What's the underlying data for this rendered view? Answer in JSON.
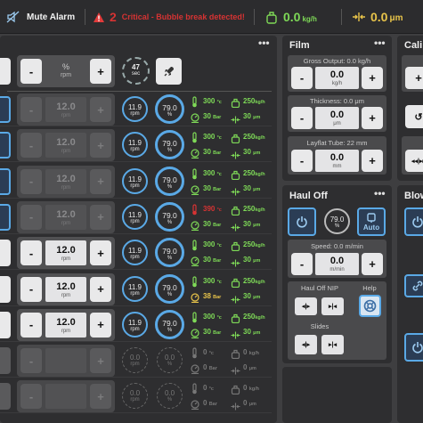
{
  "topbar": {
    "mute_label": "Mute Alarm",
    "alarm_count": "2",
    "alarm_text": "Critical - Bubble break detected!",
    "speed_value": "0.0",
    "speed_unit": "kg/h",
    "thickness_value": "0.0",
    "thickness_unit": "μm"
  },
  "extruder": {
    "header": {
      "value": "%",
      "unit": "rpm",
      "minus": "-",
      "plus": "+",
      "timer_value": "47",
      "timer_unit": "sec"
    },
    "rows": [
      {
        "rpm": "12.0",
        "unit": "rpm",
        "active": false,
        "current": "11.9",
        "current_unit": "rpm",
        "load": "79.0",
        "load_unit": "%",
        "temp": "300",
        "temp_unit": "°c",
        "pressure": "30",
        "pressure_unit": "Bar",
        "output": "250",
        "output_unit": "kg/h",
        "thickness": "30",
        "thickness_unit": "μm",
        "temp_alarm": false,
        "pressure_warn": false
      },
      {
        "rpm": "12.0",
        "unit": "rpm",
        "active": false,
        "current": "11.9",
        "current_unit": "rpm",
        "load": "79.0",
        "load_unit": "%",
        "temp": "300",
        "temp_unit": "°c",
        "pressure": "30",
        "pressure_unit": "Bar",
        "output": "250",
        "output_unit": "kg/h",
        "thickness": "30",
        "thickness_unit": "μm",
        "temp_alarm": false,
        "pressure_warn": false
      },
      {
        "rpm": "12.0",
        "unit": "rpm",
        "active": false,
        "current": "11.9",
        "current_unit": "rpm",
        "load": "79.0",
        "load_unit": "%",
        "temp": "300",
        "temp_unit": "°c",
        "pressure": "30",
        "pressure_unit": "Bar",
        "output": "250",
        "output_unit": "kg/h",
        "thickness": "30",
        "thickness_unit": "μm",
        "temp_alarm": false,
        "pressure_warn": false
      },
      {
        "rpm": "12.0",
        "unit": "rpm",
        "active": false,
        "current": "11.9",
        "current_unit": "rpm",
        "load": "79.0",
        "load_unit": "%",
        "temp": "390",
        "temp_unit": "°c",
        "pressure": "30",
        "pressure_unit": "Bar",
        "output": "250",
        "output_unit": "kg/h",
        "thickness": "30",
        "thickness_unit": "μm",
        "temp_alarm": true,
        "pressure_warn": false
      },
      {
        "rpm": "12.0",
        "unit": "rpm",
        "active": true,
        "current": "11.9",
        "current_unit": "rpm",
        "load": "79.0",
        "load_unit": "%",
        "temp": "300",
        "temp_unit": "°c",
        "pressure": "30",
        "pressure_unit": "Bar",
        "output": "250",
        "output_unit": "kg/h",
        "thickness": "30",
        "thickness_unit": "μm",
        "temp_alarm": false,
        "pressure_warn": false
      },
      {
        "rpm": "12.0",
        "unit": "rpm",
        "active": true,
        "current": "11.9",
        "current_unit": "rpm",
        "load": "79.0",
        "load_unit": "%",
        "temp": "300",
        "temp_unit": "°c",
        "pressure": "38",
        "pressure_unit": "Bar",
        "output": "250",
        "output_unit": "kg/h",
        "thickness": "30",
        "thickness_unit": "μm",
        "temp_alarm": false,
        "pressure_warn": true
      },
      {
        "rpm": "12.0",
        "unit": "rpm",
        "active": true,
        "current": "11.9",
        "current_unit": "rpm",
        "load": "79.0",
        "load_unit": "%",
        "temp": "300",
        "temp_unit": "°c",
        "pressure": "30",
        "pressure_unit": "Bar",
        "output": "250",
        "output_unit": "kg/h",
        "thickness": "30",
        "thickness_unit": "μm",
        "temp_alarm": false,
        "pressure_warn": false
      }
    ],
    "off_rows": [
      {
        "current": "0.0",
        "current_unit": "rpm",
        "load": "0.0",
        "load_unit": "%",
        "temp": "0",
        "temp_unit": "°c",
        "pressure": "0",
        "pressure_unit": "Bar",
        "output": "0",
        "output_unit": "kg/h",
        "thickness": "0",
        "thickness_unit": "μm"
      },
      {
        "current": "0.0",
        "current_unit": "rpm",
        "load": "0.0",
        "load_unit": "%",
        "temp": "0",
        "temp_unit": "°c",
        "pressure": "0",
        "pressure_unit": "Bar",
        "output": "0",
        "output_unit": "kg/h",
        "thickness": "0",
        "thickness_unit": "μm"
      }
    ]
  },
  "film": {
    "title": "Film",
    "gross_label": "Gross Output: 0.0 kg/h",
    "gross_value": "0.0",
    "gross_unit": "kg/h",
    "thickness_label": "Thickness: 0.0 μm",
    "thickness_value": "0.0",
    "thickness_unit": "μm",
    "layflat_label": "Layflat Tube: 22 mm",
    "layflat_value": "0.0",
    "layflat_unit": "mm",
    "minus": "-",
    "plus": "+"
  },
  "haul_off": {
    "title": "Haul Off",
    "load": "79.0",
    "load_unit": "%",
    "auto_label": "Auto",
    "speed_label": "Speed: 0.0 m/min",
    "speed_value": "0.0",
    "speed_unit": "m/min",
    "nip_label": "Haul Off NIP",
    "help_label": "Help",
    "slides_label": "Slides",
    "minus": "-",
    "plus": "+"
  },
  "right1": {
    "title": "Cali"
  },
  "right2": {
    "title": "Blow"
  },
  "colors": {
    "accent_blue": "#5aa9e6",
    "ok_green": "#7ed957",
    "alarm_red": "#d63333",
    "warn_yellow": "#e8c44a"
  }
}
